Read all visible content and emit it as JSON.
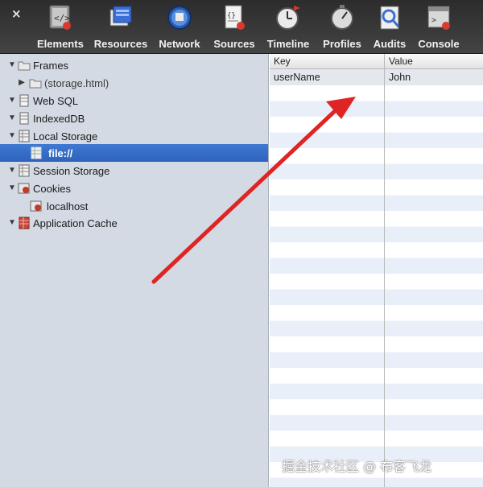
{
  "toolbar": {
    "close_label": "×",
    "tabs": [
      {
        "label": "Elements",
        "icon": "elements-icon"
      },
      {
        "label": "Resources",
        "icon": "resources-icon"
      },
      {
        "label": "Network",
        "icon": "network-icon"
      },
      {
        "label": "Sources",
        "icon": "sources-icon"
      },
      {
        "label": "Timeline",
        "icon": "timeline-icon"
      },
      {
        "label": "Profiles",
        "icon": "profiles-icon"
      },
      {
        "label": "Audits",
        "icon": "audits-icon"
      },
      {
        "label": "Console",
        "icon": "console-icon"
      }
    ]
  },
  "sidebar": {
    "items": [
      {
        "label": "Frames",
        "expanded": true,
        "icon": "folder-icon"
      },
      {
        "label": "(storage.html)",
        "expanded": false,
        "icon": "folder-icon"
      },
      {
        "label": "Web SQL",
        "expanded": true,
        "icon": "database-icon"
      },
      {
        "label": "IndexedDB",
        "expanded": true,
        "icon": "database-icon"
      },
      {
        "label": "Local Storage",
        "expanded": true,
        "icon": "storage-grid-icon"
      },
      {
        "label": "file://",
        "selected": true,
        "icon": "storage-grid-icon"
      },
      {
        "label": "Session Storage",
        "expanded": true,
        "icon": "storage-grid-icon"
      },
      {
        "label": "Cookies",
        "expanded": true,
        "icon": "cookie-icon"
      },
      {
        "label": "localhost",
        "icon": "cookie-icon"
      },
      {
        "label": "Application Cache",
        "expanded": true,
        "icon": "app-cache-icon"
      }
    ]
  },
  "grid": {
    "columns": {
      "key": "Key",
      "value": "Value"
    },
    "rows": [
      {
        "key": "userName",
        "value": "John"
      }
    ]
  },
  "annotation": {
    "arrow_color": "#e02424"
  },
  "watermark": "掘金技术社区 @ 布客飞龙"
}
